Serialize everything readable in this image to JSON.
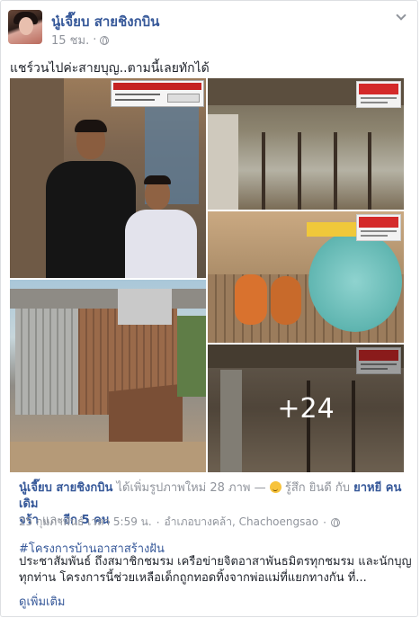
{
  "post": {
    "author": "นู๋เจี๊ยบ สายชิงกบิน",
    "time": "15 ชม.",
    "privacy_separator": "·",
    "text": "แชร์วนไปค่ะสายบุญ..ตามนี้เลยทักได้"
  },
  "photos": {
    "more_count": "+24"
  },
  "shared": {
    "author": "นู๋เจี๊ยบ สายชิงกบิน",
    "action": " ได้เพิ่มรูปภาพใหม่ 28 ภาพ — ",
    "feeling": " รู้สึก ยินดี กับ ",
    "friend1": "ยาหยี คนเดิม",
    "friend2": "จร้า",
    "and_others": " และ",
    "others_link": "อีก 5 คน",
    "date": "25 กุมภาพันธ์ เวลา 5:59 น.",
    "dot": "·",
    "location": "อำเภอบางคล้า, Chachoengsao",
    "hashtag": "#โครงการบ้านอาสาสร้างฝัน",
    "description": "ประชาสัมพันธ์ ถึงสมาชิกชมรม เครือข่ายจิตอาสาพันธมิตรทุกชมรม และนักบุญทุกท่าน โครงการนี้ช่วยเหลือเด็กถูกทอดทิ้งจากพ่อแม่ที่แยกทางกัน ที่...",
    "see_more": "ดูเพิ่มเติม"
  },
  "colors": {
    "link": "#365899",
    "muted": "#90949c",
    "text": "#1d2129"
  }
}
